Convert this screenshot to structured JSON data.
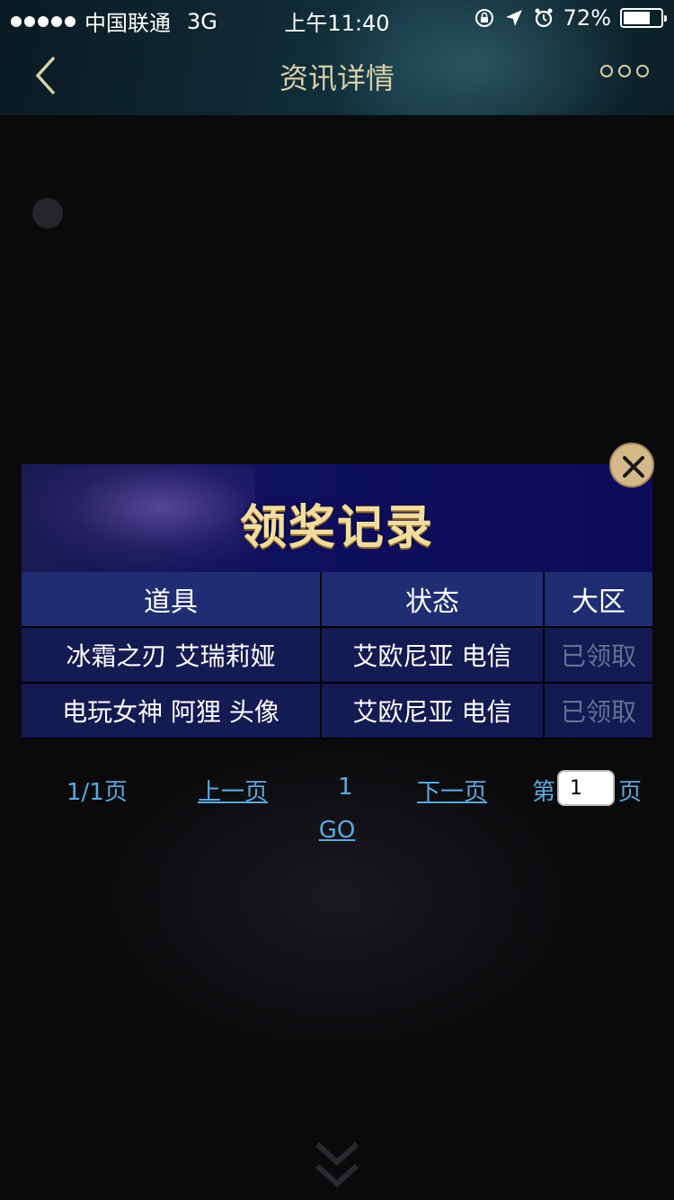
{
  "status_bar": {
    "carrier": "中国联通",
    "network": "3G",
    "time": "上午11:40",
    "battery": "72%",
    "battery_level": 0.72
  },
  "navbar": {
    "title": "资讯详情",
    "back_icon": "chevron-left-icon",
    "more_icon": "more-dots-icon"
  },
  "colors": {
    "nav_title": "#d9cfa8",
    "modal_header_bg": "#101060",
    "table_header_bg": "#1f2d73",
    "table_cell_bg": "#141a52",
    "link": "#5aa8e0",
    "claimed_status": "#6a6f92",
    "close_button": "#d6b98a"
  },
  "modal": {
    "title": "领奖记录",
    "close_icon": "close-icon",
    "table": {
      "headers": [
        "道具",
        "状态",
        "大区"
      ],
      "rows": [
        {
          "item": "冰霜之刃 艾瑞莉娅",
          "region": "艾欧尼亚 电信",
          "status": "已领取"
        },
        {
          "item": "电玩女神 阿狸 头像",
          "region": "艾欧尼亚 电信",
          "status": "已领取"
        }
      ]
    },
    "pager": {
      "total": "1/1页",
      "prev": "上一页",
      "current": "1",
      "next": "下一页",
      "jump_prefix": "第",
      "jump_value": "1",
      "jump_suffix": "页",
      "go": "GO"
    }
  }
}
